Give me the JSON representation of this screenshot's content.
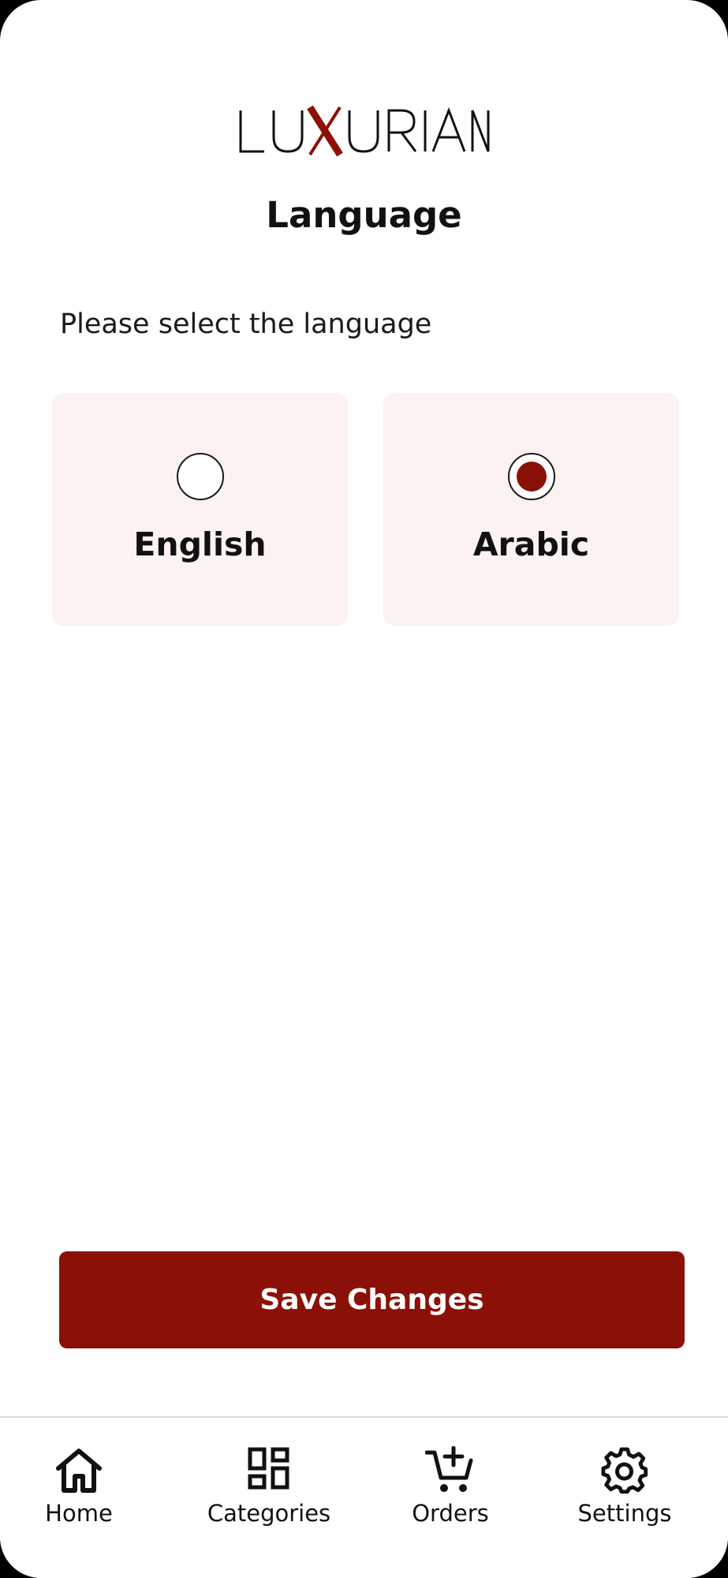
{
  "brand": {
    "logo_text": "LUXURIAN",
    "accent_color": "#8b1108"
  },
  "page": {
    "title": "Language",
    "prompt": "Please select the language"
  },
  "language_options": [
    {
      "label": "English",
      "selected": false
    },
    {
      "label": "Arabic",
      "selected": true
    }
  ],
  "actions": {
    "save_label": "Save Changes"
  },
  "bottom_nav": [
    {
      "label": "Home",
      "icon": "home-icon"
    },
    {
      "label": "Categories",
      "icon": "categories-grid-icon"
    },
    {
      "label": "Orders",
      "icon": "cart-add-icon"
    },
    {
      "label": "Settings",
      "icon": "gear-icon"
    }
  ]
}
